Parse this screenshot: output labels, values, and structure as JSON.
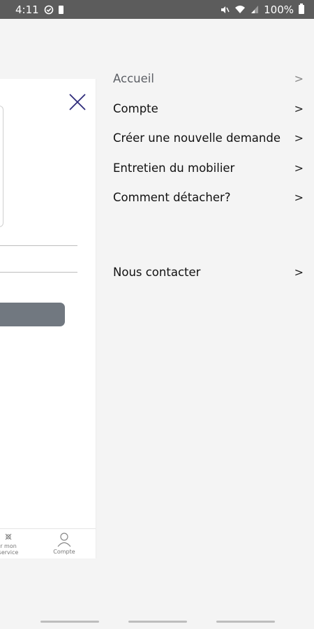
{
  "status_bar": {
    "time": "4:11",
    "battery": "100%",
    "icons": [
      "check-circle-icon",
      "battery-icon",
      "mute-icon",
      "wifi-icon",
      "signal-icon",
      "battery-icon"
    ]
  },
  "menu": {
    "items": [
      {
        "label": "Accueil",
        "chevron": ">"
      },
      {
        "label": "Compte",
        "chevron": ">"
      },
      {
        "label": "Créer une nouvelle demande",
        "chevron": ">"
      },
      {
        "label": "Entretien du mobilier",
        "chevron": ">"
      },
      {
        "label": "Comment détacher?",
        "chevron": ">"
      },
      {
        "label": "Nous contacter",
        "chevron": ">"
      }
    ]
  },
  "panel": {
    "close_icon": "close-icon",
    "accent_color": "#2e2a7a",
    "button_color": "#717880",
    "bottom_nav": {
      "service_label_1": "r mon",
      "service_label_2": "service",
      "compte_label": "Compte"
    }
  }
}
